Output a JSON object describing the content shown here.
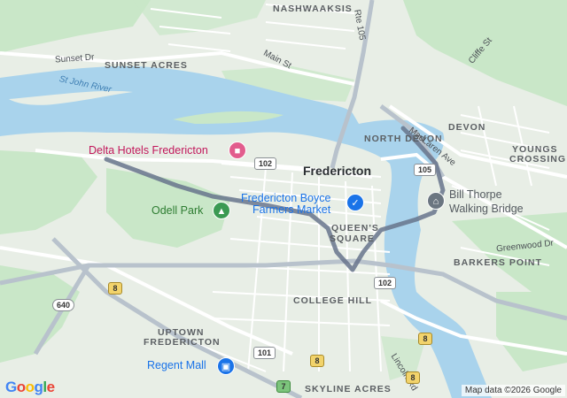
{
  "map": {
    "provider_logo": "Google",
    "attribution": "Map data ©2026 Google",
    "colors": {
      "land": "#e8eee6",
      "park": "#c9e7c8",
      "water": "#a9d3ec",
      "road": "#ffffff",
      "highway": "#b8c2cc",
      "route": "#67748c",
      "hotel_pin": "#e25c8d",
      "park_pin": "#3a9a52",
      "shopping_pin": "#1a73e8",
      "landmark_pin": "#6b7681"
    }
  },
  "areas": {
    "nashwaaksis": "NASHWAAKSIS",
    "sunset_acres": "SUNSET ACRES",
    "north_devon": "NORTH DEVON",
    "devon": "DEVON",
    "youngs_crossing_1": "YOUNGS",
    "youngs_crossing_2": "CROSSING",
    "queens_square_1": "QUEEN'S",
    "queens_square_2": "SQUARE",
    "barkers_point": "BARKERS POINT",
    "college_hill": "COLLEGE HILL",
    "uptown_1": "UPTOWN",
    "uptown_2": "FREDERICTON",
    "skyline_acres": "SKYLINE ACRES"
  },
  "city": "Fredericton",
  "water": {
    "river": "St John River"
  },
  "streets": {
    "sunset_dr": "Sunset Dr",
    "main_st": "Main St",
    "maclaren_ave": "MacLaren Ave",
    "cliffe_st": "Cliffe St",
    "greenwood_dr": "Greenwood Dr",
    "lincoln_rd": "Lincoln Rd",
    "route_105_label": "Rte 105"
  },
  "places": {
    "hotel": "Delta Hotels Fredericton",
    "park": "Odell Park",
    "market_1": "Fredericton Boyce",
    "market_2": "Farmers Market",
    "bridge_1": "Bill Thorpe",
    "bridge_2": "Walking Bridge",
    "mall": "Regent Mall"
  },
  "icons": {
    "hotel": "bed-icon",
    "park": "tree-icon",
    "market": "shopping-cart-icon",
    "bridge": "bridge-icon",
    "mall": "shopping-bag-icon"
  },
  "shields": {
    "r102_a": "102",
    "r102_b": "102",
    "r105": "105",
    "r8_a": "8",
    "r8_b": "8",
    "r8_c": "8",
    "r8_d": "8",
    "r640": "640",
    "r101": "101",
    "r7": "7"
  }
}
